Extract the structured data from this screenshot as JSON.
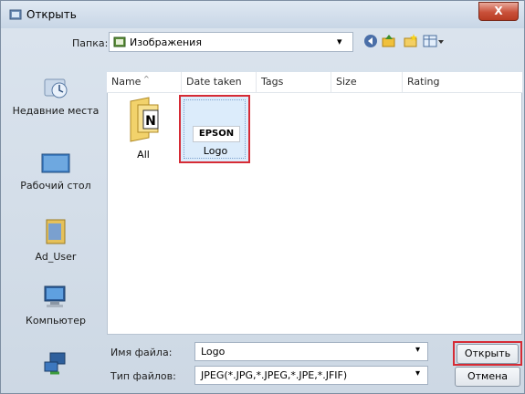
{
  "window": {
    "title": "Открыть",
    "close_label": "X"
  },
  "toolbar": {
    "folder_label": "Папка:",
    "folder_value": "Изображения",
    "dropdown_arrow": "▾"
  },
  "places": [
    {
      "label": "Недавние места"
    },
    {
      "label": "Рабочий стол"
    },
    {
      "label": "Ad_User"
    },
    {
      "label": "Компьютер"
    }
  ],
  "columns": [
    "Name",
    "Date taken",
    "Tags",
    "Size",
    "Rating"
  ],
  "files": [
    {
      "name": "All",
      "thumb_letter": "N"
    },
    {
      "name": "Logo",
      "thumb_text": "EPSON"
    }
  ],
  "filename": {
    "label": "Имя файла:",
    "value": "Logo"
  },
  "filetype": {
    "label": "Тип файлов:",
    "value": "JPEG(*.JPG,*.JPEG,*.JPE,*.JFIF)"
  },
  "buttons": {
    "open": "Открыть",
    "cancel": "Отмена"
  },
  "colors": {
    "highlight": "#d62b35",
    "selection": "#dcecfb"
  }
}
